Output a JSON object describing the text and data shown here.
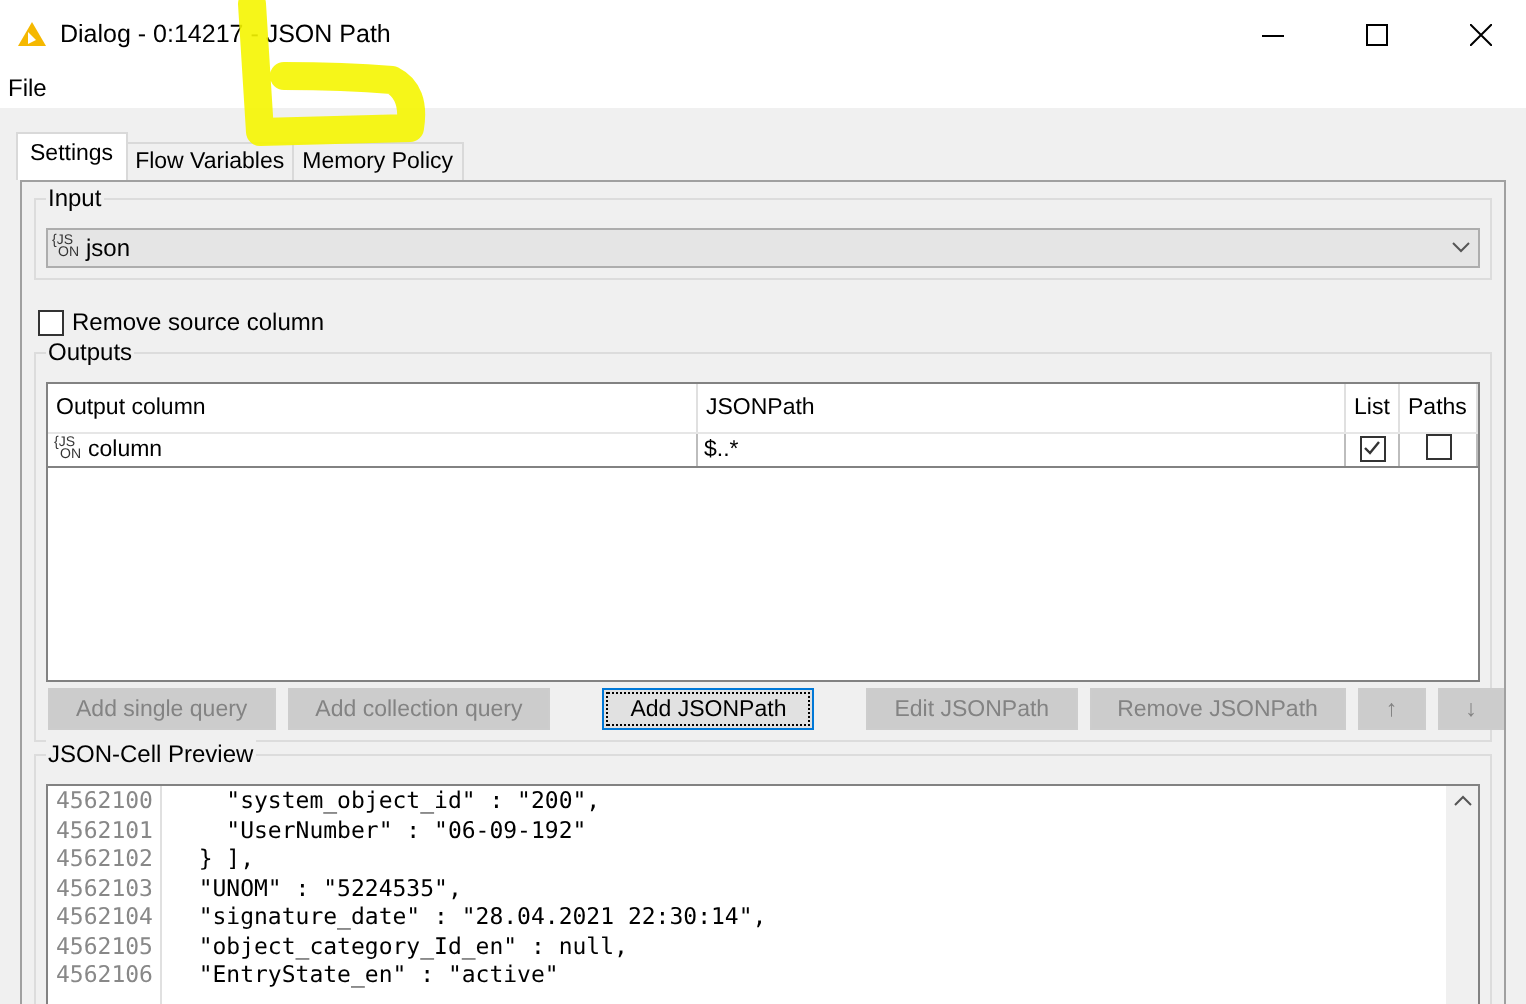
{
  "window": {
    "title": "Dialog - 0:14217 - JSON Path"
  },
  "menu": [
    "File"
  ],
  "tabs": [
    {
      "label": "Settings",
      "selected": true
    },
    {
      "label": "Flow Variables",
      "selected": false
    },
    {
      "label": "Memory Policy",
      "selected": false
    }
  ],
  "input": {
    "label": "Input",
    "type_badge": [
      "{JS",
      "ON"
    ],
    "value": "json"
  },
  "remove_source_column": {
    "label": "Remove source column",
    "checked": false
  },
  "outputs": {
    "label": "Outputs",
    "columns": [
      "Output column",
      "JSONPath",
      "List",
      "Paths"
    ],
    "rows": [
      {
        "type_badge": [
          "{JS",
          "ON"
        ],
        "output_column": "column",
        "json_path": "$..*",
        "list": true,
        "paths": false
      }
    ]
  },
  "buttons": [
    {
      "label": "Add single query",
      "disabled": true,
      "focused": false
    },
    {
      "label": "Add collection query",
      "disabled": true,
      "focused": false
    },
    {
      "label": "Add JSONPath",
      "disabled": false,
      "focused": true
    },
    {
      "label": "Edit JSONPath",
      "disabled": true,
      "focused": false
    },
    {
      "label": "Remove JSONPath",
      "disabled": true,
      "focused": false
    },
    {
      "label": "↑",
      "disabled": true,
      "focused": false
    },
    {
      "label": "↓",
      "disabled": true,
      "focused": false
    }
  ],
  "preview": {
    "label": "JSON-Cell Preview",
    "lines": [
      {
        "number": "4562100",
        "text": "    \"system_object_id\" : \"200\","
      },
      {
        "number": "4562101",
        "text": "    \"UserNumber\" : \"06-09-192\""
      },
      {
        "number": "4562102",
        "text": "  } ],"
      },
      {
        "number": "4562103",
        "text": "  \"UNOM\" : \"5224535\","
      },
      {
        "number": "4562104",
        "text": "  \"signature_date\" : \"28.04.2021 22:30:14\","
      },
      {
        "number": "4562105",
        "text": "  \"object_category_Id_en\" : null,"
      },
      {
        "number": "4562106",
        "text": "  \"EntryState_en\" : \"active\""
      }
    ]
  }
}
